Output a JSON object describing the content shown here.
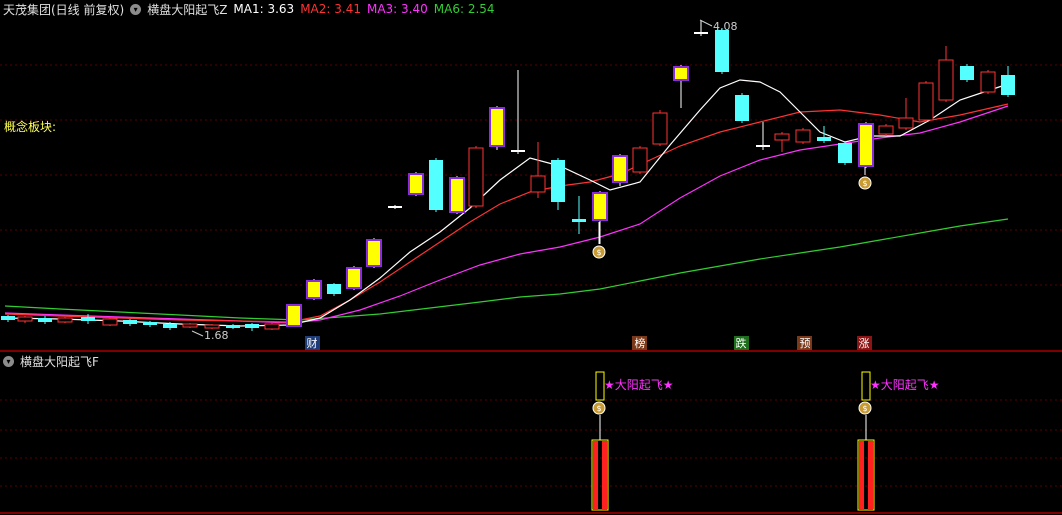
{
  "header": {
    "stock": "天茂集团(日线 前复权)",
    "indicator": "横盘大阳起飞Z",
    "ma1_label": "MA1: 3.63",
    "ma2_label": "MA2: 3.41",
    "ma3_label": "MA3: 3.40",
    "ma6_label": "MA6: 2.54"
  },
  "concept_label": "概念板块:",
  "annotations": {
    "high": "4.08",
    "low": "1.68"
  },
  "markers": [
    "财",
    "榜",
    "跌",
    "预",
    "涨"
  ],
  "sub": {
    "title": "横盘大阳起飞F",
    "signal_text": "★大阳起飞★"
  },
  "colors": {
    "bg": "#000000",
    "up": "#ff3232",
    "down": "#54ffff",
    "hl": "#ffff00",
    "ma1": "#ffffff",
    "ma2": "#ff3232",
    "ma3": "#ff32ff",
    "ma6": "#32cd32",
    "grid": "#5a0000",
    "axis": "#ff0000"
  }
}
